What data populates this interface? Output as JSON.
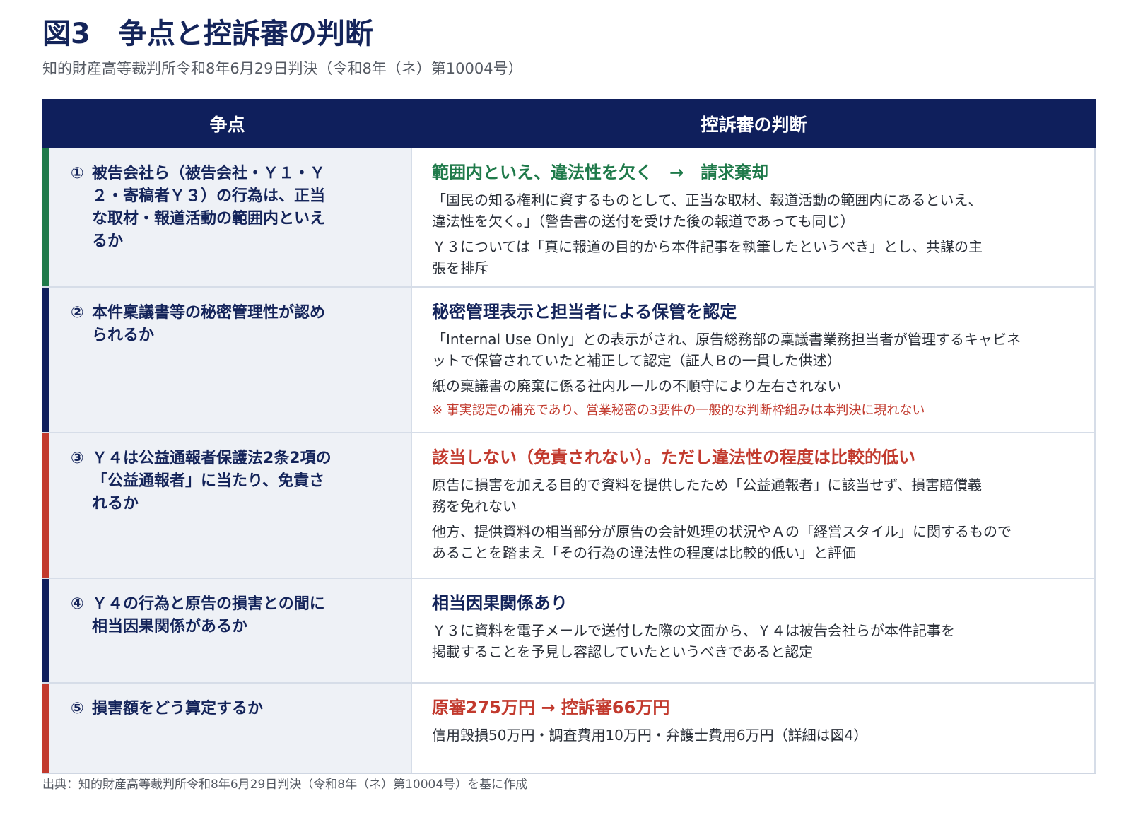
{
  "title": "図3　争点と控訴審の判断",
  "subtitle": "知的財産高等裁判所令和8年6月29日判決（令和8年（ネ）第10004号）",
  "table": {
    "headers": {
      "issue": "争点",
      "ruling": "控訴審の判断"
    },
    "rows": [
      {
        "num": "①",
        "issue": "被告会社ら（被告会社・Ｙ１・Ｙ２・寄稿者Ｙ３）の行為は、正当な取材・報道活動の範囲内といえるか",
        "accent": "#1f7a4a",
        "headline": "範囲内といえ、違法性を欠く　→　請求棄却",
        "headline_color": "#1f7a4a",
        "paragraphs": [
          "「国民の知る権利に資するものとして、正当な取材、報道活動の範囲内にあるといえ、違法性を欠く。」（警告書の送付を受けた後の報道であっても同じ）",
          "Ｙ３については「真に報道の目的から本件記事を執筆したというべき」とし、共謀の主張を排斥"
        ],
        "note": ""
      },
      {
        "num": "②",
        "issue": "本件稟議書等の秘密管理性が認められるか",
        "accent": "#0f1f5c",
        "headline": "秘密管理表示と担当者による保管を認定",
        "headline_color": "#14245a",
        "paragraphs": [
          "「Internal Use Only」との表示がされ、原告総務部の稟議書業務担当者が管理するキャビネットで保管されていたと補正して認定（証人Ｂの一貫した供述）",
          "紙の稟議書の廃棄に係る社内ルールの不順守により左右されない"
        ],
        "note": "※ 事実認定の補充であり、営業秘密の3要件の一般的な判断枠組みは本判決に現れない"
      },
      {
        "num": "③",
        "issue": "Ｙ４は公益通報者保護法2条2項の「公益通報者」に当たり、免責されるか",
        "accent": "#c23a2e",
        "headline": "該当しない（免責されない）。ただし違法性の程度は比較的低い",
        "headline_color": "#c23a2e",
        "paragraphs": [
          "原告に損害を加える目的で資料を提供したため「公益通報者」に該当せず、損害賠償義務を免れない",
          "他方、提供資料の相当部分が原告の会計処理の状況やＡの「経営スタイル」に関するものであることを踏まえ「その行為の違法性の程度は比較的低い」と評価"
        ],
        "note": ""
      },
      {
        "num": "④",
        "issue": "Ｙ４の行為と原告の損害との間に相当因果関係があるか",
        "accent": "#0f1f5c",
        "headline": "相当因果関係あり",
        "headline_color": "#14245a",
        "paragraphs": [
          "Ｙ３に資料を電子メールで送付した際の文面から、Ｙ４は被告会社らが本件記事を掲載することを予見し容認していたというべきであると認定"
        ],
        "note": ""
      },
      {
        "num": "⑤",
        "issue": "損害額をどう算定するか",
        "accent": "#c23a2e",
        "headline": "原審275万円 → 控訴審66万円",
        "headline_color": "#c23a2e",
        "paragraphs": [
          "信用毀損50万円・調査費用10万円・弁護士費用6万円（詳細は図4）"
        ],
        "note": ""
      }
    ]
  },
  "source": "出典：知的財産高等裁判所令和8年6月29日判決（令和8年（ネ）第10004号）を基に作成"
}
